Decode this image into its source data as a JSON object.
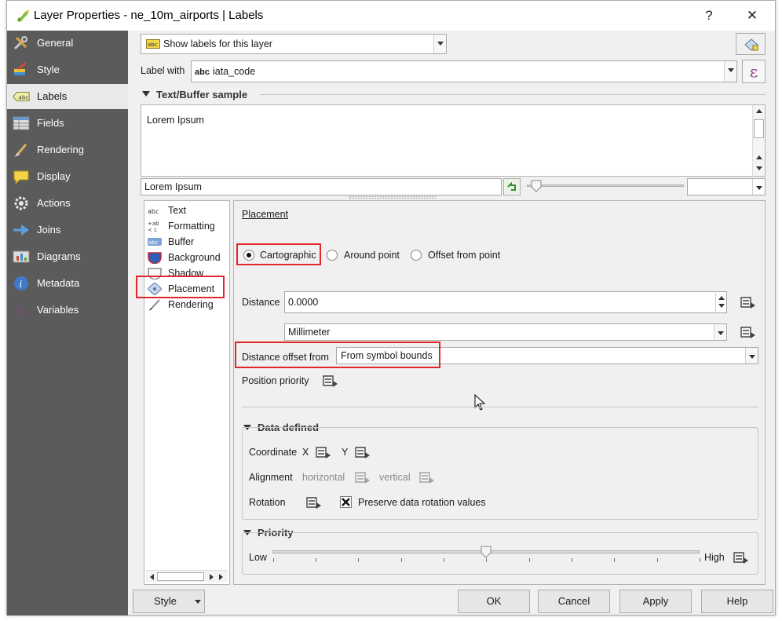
{
  "window": {
    "title": "Layer Properties - ne_10m_airports | Labels",
    "help_glyph": "?",
    "close_glyph": "✕"
  },
  "sidebar": {
    "items": [
      {
        "label": "General",
        "icon": "wrench-icon"
      },
      {
        "label": "Style",
        "icon": "paintbrush-icon"
      },
      {
        "label": "Labels",
        "icon": "abc-label-icon"
      },
      {
        "label": "Fields",
        "icon": "table-icon"
      },
      {
        "label": "Rendering",
        "icon": "brush-icon"
      },
      {
        "label": "Display",
        "icon": "speech-bubble-icon"
      },
      {
        "label": "Actions",
        "icon": "gear-icon"
      },
      {
        "label": "Joins",
        "icon": "join-arrow-icon"
      },
      {
        "label": "Diagrams",
        "icon": "diagram-icon"
      },
      {
        "label": "Metadata",
        "icon": "info-icon"
      },
      {
        "label": "Variables",
        "icon": "epsilon-icon"
      }
    ],
    "active_index": 2
  },
  "top": {
    "mode_select": "Show labels for this layer",
    "label_with_caption": "Label with",
    "label_with_value": "iata_code",
    "field_badge": "abc",
    "expression_glyph": "ε"
  },
  "sample": {
    "section_title": "Text/Buffer sample",
    "preview_text": "Lorem Ipsum",
    "input_value": "Lorem Ipsum",
    "scale_value": ""
  },
  "tabs": {
    "items": [
      {
        "label": "Text",
        "icon": "abc-text-icon"
      },
      {
        "label": "Formatting",
        "icon": "formatting-icon"
      },
      {
        "label": "Buffer",
        "icon": "abc-buffer-icon"
      },
      {
        "label": "Background",
        "icon": "shield-icon"
      },
      {
        "label": "Shadow",
        "icon": "shadow-icon"
      },
      {
        "label": "Placement",
        "icon": "placement-icon"
      },
      {
        "label": "Rendering",
        "icon": "rendering-brush-icon"
      }
    ],
    "active_index": 5
  },
  "placement": {
    "heading": "Placement",
    "modes": [
      {
        "label": "Cartographic",
        "checked": true
      },
      {
        "label": "Around point",
        "checked": false
      },
      {
        "label": "Offset from point",
        "checked": false
      }
    ],
    "distance_label": "Distance",
    "distance_value": "0.0000",
    "unit_value": "Millimeter",
    "offset_from_label": "Distance offset from",
    "offset_from_value": "From symbol bounds",
    "position_priority_label": "Position priority"
  },
  "data_defined": {
    "title": "Data defined",
    "coord_label": "Coordinate",
    "x_label": "X",
    "y_label": "Y",
    "alignment_label": "Alignment",
    "horizontal_label": "horizontal",
    "vertical_label": "vertical",
    "rotation_label": "Rotation",
    "preserve_label": "Preserve data rotation values",
    "preserve_checked": true
  },
  "priority": {
    "title": "Priority",
    "low_label": "Low",
    "high_label": "High",
    "value_percent": 50
  },
  "footer": {
    "style_button": "Style",
    "ok": "OK",
    "cancel": "Cancel",
    "apply": "Apply",
    "help": "Help"
  },
  "colors": {
    "sidebar_bg": "#5b5b5b",
    "highlight_red": "#e2262c",
    "expression_purple": "#8a3d8e"
  }
}
